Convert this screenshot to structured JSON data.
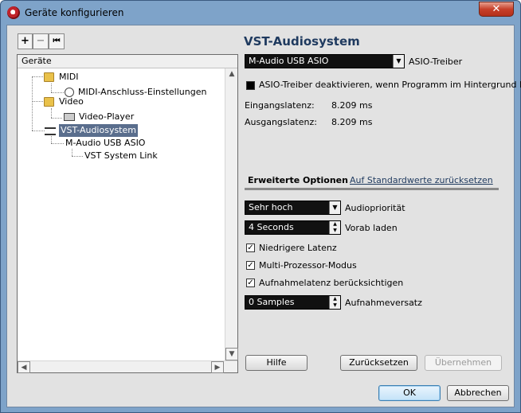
{
  "window": {
    "title": "Geräte konfigurieren",
    "close_label": "✕"
  },
  "tree": {
    "header": "Geräte",
    "nodes": [
      {
        "label": "MIDI"
      },
      {
        "label": "MIDI-Anschluss-Einstellungen"
      },
      {
        "label": "Video"
      },
      {
        "label": "Video-Player"
      },
      {
        "label": "VST-Audiosystem"
      },
      {
        "label": "M-Audio USB ASIO"
      },
      {
        "label": "VST System Link"
      }
    ]
  },
  "toolbar": {
    "add": "+",
    "remove": "−",
    "reset": "⏮"
  },
  "panel": {
    "title": "VST-Audiosystem",
    "driver": {
      "value": "M-Audio USB ASIO",
      "label": "ASIO-Treiber"
    },
    "deactivate_label": "ASIO-Treiber deaktivieren, wenn Programm im Hintergrund läuft",
    "input_latency": {
      "label": "Eingangslatenz:",
      "value": "8.209 ms"
    },
    "output_latency": {
      "label": "Ausgangslatenz:",
      "value": "8.209 ms"
    },
    "tab_advanced": "Erweiterte Optionen",
    "tab_reset": "Auf Standardwerte zurücksetzen",
    "priority": {
      "value": "Sehr hoch",
      "label": "Audiopriorität"
    },
    "preload": {
      "value": "4 Seconds",
      "label": "Vorab laden"
    },
    "low_latency": {
      "label": "Niedrigere Latenz",
      "checked": true
    },
    "multi_processor": {
      "label": "Multi-Prozessor-Modus",
      "checked": true
    },
    "record_latency": {
      "label": "Aufnahmelatenz berücksichtigen",
      "checked": true
    },
    "record_offset": {
      "value": "0 Samples",
      "label": "Aufnahmeversatz"
    }
  },
  "buttons": {
    "help": "Hilfe",
    "reset": "Zurücksetzen",
    "apply": "Übernehmen",
    "ok": "OK",
    "cancel": "Abbrechen"
  }
}
